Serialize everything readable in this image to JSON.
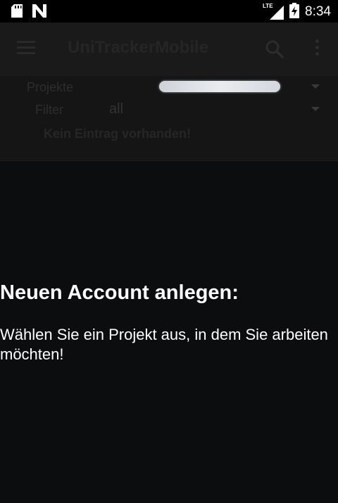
{
  "status_bar": {
    "time": "8:34",
    "network_label": "LTE",
    "icons": [
      "sd-card-icon",
      "n-notification-icon",
      "signal-icon",
      "battery-charging-icon"
    ]
  },
  "app_bar": {
    "title": "UniTrackerMobile",
    "icons": [
      "menu-icon",
      "search-icon",
      "more-vert-icon"
    ]
  },
  "filters": {
    "project_label": "Projekte",
    "filter_label": "Filter",
    "filter_value": "all",
    "empty_message": "Kein Eintrag vorhanden!"
  },
  "overlay": {
    "title": "Neuen Account anlegen:",
    "text": "Wählen Sie ein Projekt aus, in dem Sie arbeiten möchten!"
  },
  "colors": {
    "background": "#0c0d0f",
    "text": "#ffffff"
  }
}
